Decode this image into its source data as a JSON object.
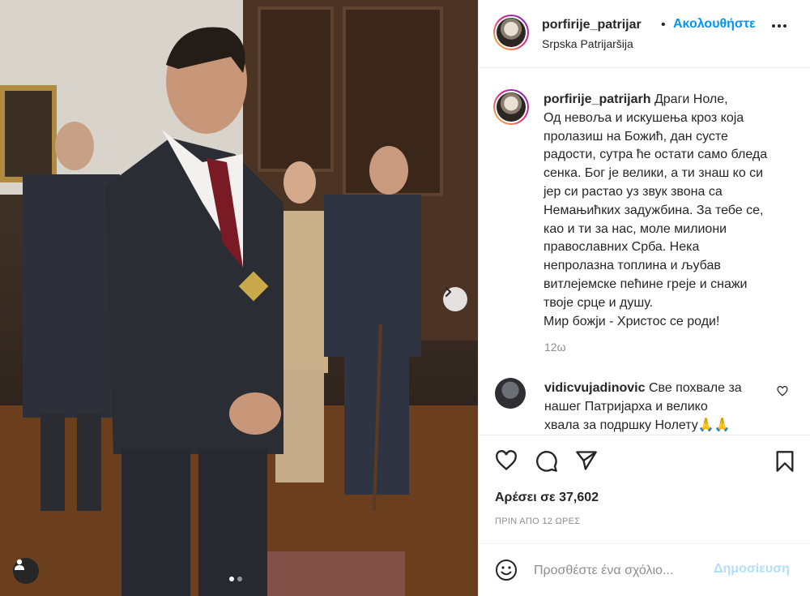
{
  "post": {
    "username": "porfirije_patrijar",
    "separator": "•",
    "follow_label": "Ακολουθήστε",
    "location": "Srpska Patrijaršija"
  },
  "caption": {
    "username": "porfirije_patrijarh",
    "lines": [
      "Драги Ноле,",
      "Од невоља и искушења кроз која",
      "пролазиш на Божић, дан сусте",
      "радости, сутра ће остати само бледа",
      "сенка. Бог је велики, а ти знаш ко си",
      "јер си растао уз звук звона са",
      "Немањићких задужбина. За тебе се,",
      "као и ти за нас, моле милиони",
      "православних Срба. Нека",
      "непролазна топлина и љубав",
      "витлејемске пећине греје и снажи",
      "твоје срце и душу.",
      "Мир божји - Христос се роди!"
    ],
    "time": "12ω"
  },
  "comment": {
    "username": "vidicvujadinovic",
    "line1": "Све похвале за",
    "line2": "нашег Патријарха и велико",
    "line3": "хвала за подршку Нолету🙏🙏"
  },
  "actions": {
    "likes": "Αρέσει σε 37,602",
    "ago": "ΠΡΙΝ ΑΠΟ 12 ΩΡΕΣ"
  },
  "add_comment": {
    "placeholder": "Προσθέστε ένα σχόλιο...",
    "post_label": "Δημοσίευση"
  },
  "colors": {
    "link": "#0095f6",
    "post_disabled": "#b2dffc",
    "secondary_text": "#8e8e8e"
  },
  "icons": [
    "heart-icon",
    "comment-icon",
    "share-icon",
    "bookmark-icon",
    "more-icon",
    "emoji-icon",
    "user-tag-icon",
    "chevron-right-icon"
  ]
}
